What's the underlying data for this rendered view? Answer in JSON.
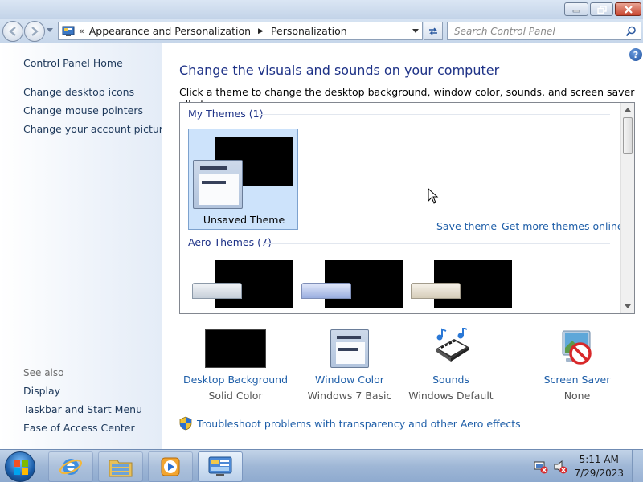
{
  "window": {
    "breadcrumb": [
      "Appearance and Personalization",
      "Personalization"
    ],
    "search_placeholder": "Search Control Panel"
  },
  "sidebar": {
    "home": "Control Panel Home",
    "links": [
      "Change desktop icons",
      "Change mouse pointers",
      "Change your account picture"
    ],
    "see_also_label": "See also",
    "see_also": [
      "Display",
      "Taskbar and Start Menu",
      "Ease of Access Center"
    ]
  },
  "main": {
    "title": "Change the visuals and sounds on your computer",
    "subtitle": "Click a theme to change the desktop background, window color, sounds, and screen saver all at once.",
    "my_themes_header": "My Themes (1)",
    "unsaved_theme": "Unsaved Theme",
    "save_theme": "Save theme",
    "get_more_themes": "Get more themes online",
    "aero_themes_header": "Aero Themes (7)"
  },
  "bottom_items": [
    {
      "title": "Desktop Background",
      "sub": "Solid Color",
      "icon": "desktop-background-icon"
    },
    {
      "title": "Window Color",
      "sub": "Windows 7 Basic",
      "icon": "window-color-icon"
    },
    {
      "title": "Sounds",
      "sub": "Windows Default",
      "icon": "sounds-icon"
    },
    {
      "title": "Screen Saver",
      "sub": "None",
      "icon": "screen-saver-icon"
    }
  ],
  "troubleshoot": "Troubleshoot problems with transparency and other Aero effects",
  "taskbar": {
    "time": "5:11 AM",
    "date": "7/29/2023"
  },
  "colors": {
    "link": "#1e5ea8",
    "heading": "#1e3287",
    "selected_tile": "#cde3fb"
  }
}
